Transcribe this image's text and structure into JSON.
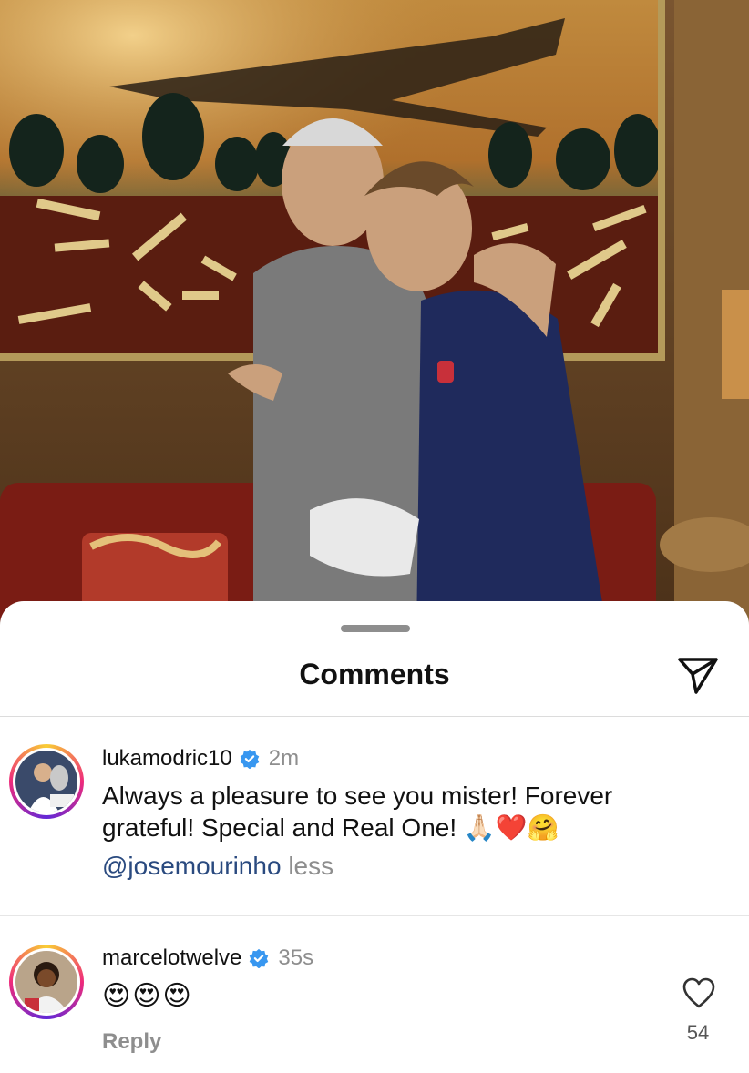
{
  "sheet": {
    "title": "Comments",
    "share_icon": "paper-plane-icon"
  },
  "comments": [
    {
      "username": "lukamodric10",
      "verified": true,
      "time": "2m",
      "text": "Always a pleasure to see you mister! Forever grateful!  Special and Real One!",
      "emojis": "🙏🏻❤️🤗",
      "mention": "@josemourinho",
      "less_label": "less"
    },
    {
      "username": "marcelotwelve",
      "verified": true,
      "time": "35s",
      "emojis": "😍😍😍",
      "reply_label": "Reply",
      "like_count": "54",
      "like_icon": "heart-outline-icon"
    }
  ]
}
